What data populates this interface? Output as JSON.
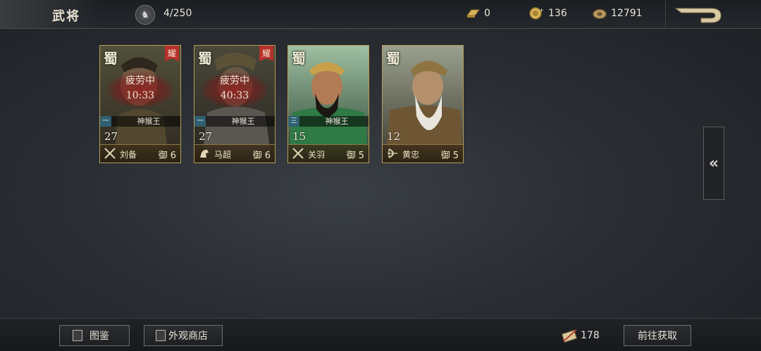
{
  "topbar": {
    "title": "武将",
    "hero_count": "4/250",
    "resources": [
      {
        "name": "gold-bar",
        "value": "0"
      },
      {
        "name": "coin",
        "value": "136"
      },
      {
        "name": "copper",
        "value": "12791"
      }
    ]
  },
  "cards": [
    {
      "faction": "蜀",
      "badge": "耀",
      "fatigue": true,
      "fatigue_label": "疲劳中",
      "fatigue_time": "10:33",
      "skill_rank": "一",
      "skill_name": "神猴王",
      "level": "27",
      "weapon_icon": "crossed-spears-icon",
      "name": "刘备",
      "cost_label": "御",
      "cost": "6"
    },
    {
      "faction": "蜀",
      "badge": "耀",
      "fatigue": true,
      "fatigue_label": "疲劳中",
      "fatigue_time": "40:33",
      "skill_rank": "一",
      "skill_name": "神猴王",
      "level": "27",
      "weapon_icon": "horse-icon",
      "name": "马超",
      "cost_label": "御",
      "cost": "6"
    },
    {
      "faction": "蜀",
      "badge": "",
      "fatigue": false,
      "fatigue_label": "",
      "fatigue_time": "",
      "skill_rank": "三",
      "skill_name": "神猴王",
      "level": "15",
      "weapon_icon": "crossed-spears-icon",
      "name": "关羽",
      "cost_label": "御",
      "cost": "5"
    },
    {
      "faction": "蜀",
      "badge": "",
      "fatigue": false,
      "fatigue_label": "",
      "fatigue_time": "",
      "skill_rank": "",
      "skill_name": "",
      "level": "12",
      "weapon_icon": "bow-icon",
      "name": "黄忠",
      "cost_label": "御",
      "cost": "5"
    }
  ],
  "side_toggle": "«",
  "bottombar": {
    "catalog_label": "图鉴",
    "shop_label": "外观商店",
    "scroll_count": "178",
    "go_obtain_label": "前往获取"
  }
}
